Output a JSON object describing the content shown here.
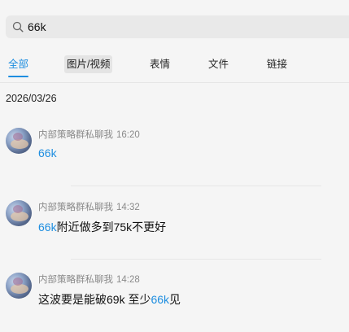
{
  "search": {
    "value": "66k",
    "icon": "search-icon"
  },
  "tabs": [
    {
      "label": "全部",
      "active": true
    },
    {
      "label": "图片/视频",
      "active": false
    },
    {
      "label": "表情",
      "active": false
    },
    {
      "label": "文件",
      "active": false
    },
    {
      "label": "链接",
      "active": false
    }
  ],
  "date_header": "2026/03/26",
  "messages": [
    {
      "sender": "内部策略群私聊我",
      "time": "16:20",
      "content_parts": [
        {
          "text": "66k",
          "highlight": true
        }
      ]
    },
    {
      "sender": "内部策略群私聊我",
      "time": "14:32",
      "content_parts": [
        {
          "text": "66k",
          "highlight": true
        },
        {
          "text": "附近做多到75k不更好",
          "highlight": false
        }
      ]
    },
    {
      "sender": "内部策略群私聊我",
      "time": "14:28",
      "content_parts": [
        {
          "text": "这波要是能破69k 至少",
          "highlight": false
        },
        {
          "text": "66k",
          "highlight": true
        },
        {
          "text": "见",
          "highlight": false
        }
      ]
    }
  ],
  "colors": {
    "accent": "#1e8ee0",
    "background": "#f5f5f5",
    "meta_text": "#8a8a8a"
  }
}
